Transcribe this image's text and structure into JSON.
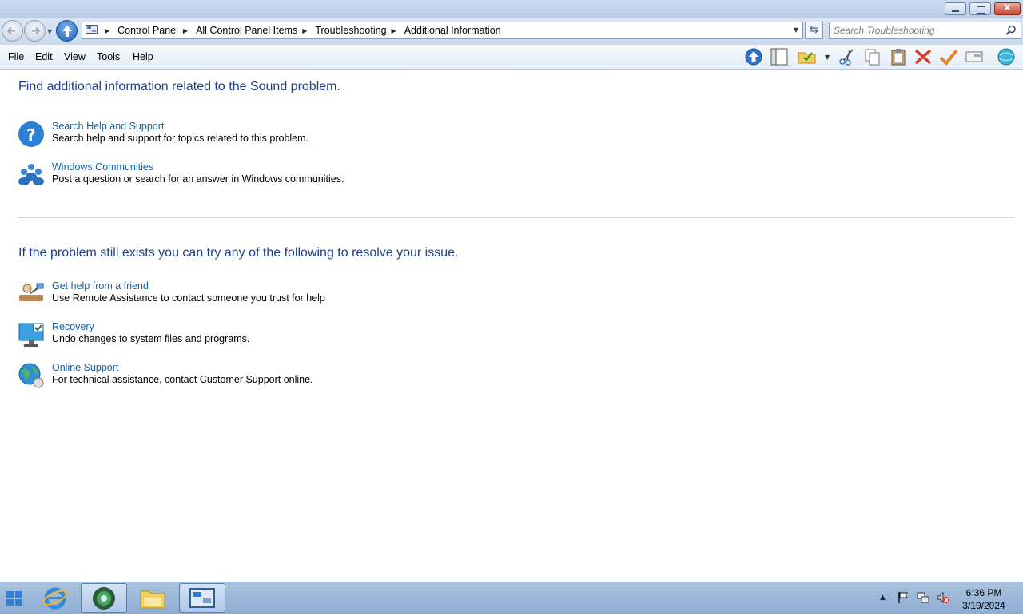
{
  "window": {
    "close_glyph": "x"
  },
  "navigation": {
    "breadcrumbs": [
      "Control Panel",
      "All Control Panel Items",
      "Troubleshooting",
      "Additional Information"
    ],
    "search_placeholder": "Search Troubleshooting"
  },
  "menu": {
    "items": [
      "File",
      "Edit",
      "View",
      "Tools",
      "Help"
    ]
  },
  "toolbar": {
    "icons": [
      "up-arrow-icon",
      "panel-icon",
      "folder-check-icon",
      "cut-icon",
      "copy-icon",
      "paste-icon",
      "delete-icon",
      "checkmark-icon",
      "properties-icon",
      "globe-icon"
    ]
  },
  "main": {
    "section1_heading": "Find additional information related to the Sound problem.",
    "section1_items": [
      {
        "title": "Search Help and Support",
        "desc": "Search help and support for topics related to this problem.",
        "icon": "help-icon"
      },
      {
        "title": "Windows Communities",
        "desc": "Post a question or search for an answer in Windows communities.",
        "icon": "communities-icon"
      }
    ],
    "section2_heading": "If the problem still exists you can try any of the following to resolve your issue.",
    "section2_items": [
      {
        "title": "Get help from a friend",
        "desc": "Use Remote Assistance to contact someone you trust for help",
        "icon": "remote-assistance-icon"
      },
      {
        "title": "Recovery",
        "desc": "Undo changes to system files and programs.",
        "icon": "recovery-icon"
      },
      {
        "title": "Online Support",
        "desc": "For technical assistance, contact Customer Support online.",
        "icon": "online-support-icon"
      }
    ]
  },
  "taskbar": {
    "apps": [
      "internet-explorer-icon",
      "media-center-icon",
      "file-explorer-icon",
      "control-panel-icon"
    ],
    "time": "6:36 PM",
    "date": "3/19/2024"
  },
  "colors": {
    "heading": "#1e3f8c",
    "link": "#1660a6",
    "taskbar": "#9db7da"
  }
}
